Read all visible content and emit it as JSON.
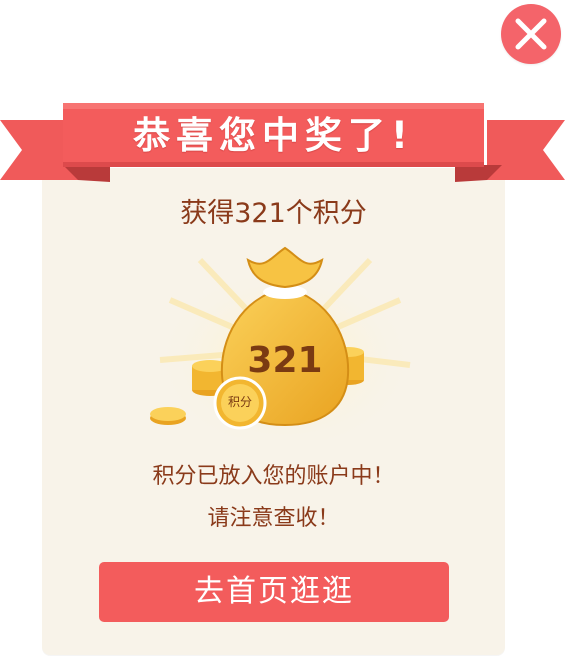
{
  "dialog": {
    "title": "恭喜您中奖了!",
    "points_text": "获得321个积分",
    "bag_amount": "321",
    "coin_label": "积分",
    "message_line1": "积分已放入您的账户中！",
    "message_line2": "请注意查收！",
    "home_button_label": "去首页逛逛",
    "close_icon": "close-icon"
  },
  "colors": {
    "ribbon": "#f35c5c",
    "ribbon_dark": "#d9484b",
    "card_bg": "#f8f3e9",
    "text_brown": "#8a3a1a",
    "button": "#f35c5c",
    "gold": "#f2b630"
  }
}
